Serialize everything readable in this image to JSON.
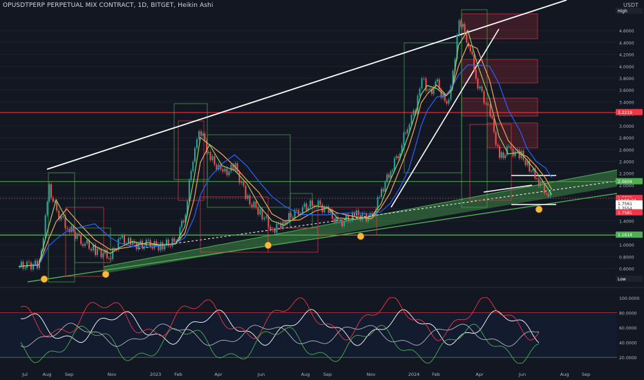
{
  "header": {
    "ticker": "OPUSDTPERP PERPETUAL MIX CONTRACT, 1D, BITGET, Heikin Ashi",
    "currency": "USDT"
  },
  "chart_data": [
    {
      "type": "line",
      "subtype": "candlestick-heikin-ashi",
      "price_axis": {
        "ticks": [
          "4.6000",
          "4.4000",
          "4.2000",
          "4.0000",
          "3.8000",
          "3.6000",
          "3.4000",
          "3.2000",
          "3.0000",
          "2.8000",
          "2.6000",
          "2.4000",
          "2.2000",
          "2.0000",
          "1.8000",
          "1.6000",
          "1.4000",
          "1.2000",
          "1.0000",
          "0.8000",
          "0.6000"
        ],
        "ylim": [
          0.35,
          4.95
        ]
      },
      "time_axis": {
        "labels": [
          "Jul",
          "Aug",
          "Sep",
          "Nov",
          "2023",
          "Feb",
          "Apr",
          "Jun",
          "Aug",
          "Sep",
          "Nov",
          "2024",
          "Feb",
          "Apr",
          "Jun",
          "Aug",
          "Sep"
        ]
      },
      "price_tags": [
        {
          "text": "High",
          "value": 4.95,
          "color": "#1e222d"
        },
        {
          "text": "3.2219",
          "value": 3.2219,
          "color": "#f23645"
        },
        {
          "text": "2.0604",
          "value": 2.0604,
          "color": "#4caf50"
        },
        {
          "text": "1.7770",
          "value": 1.777,
          "color": "#f23645"
        },
        {
          "text": "24:55:24",
          "value": 1.74,
          "color": "#f23645"
        },
        {
          "text": "1.7561",
          "value": 1.7561,
          "color": "#ffffff"
        },
        {
          "text": "1.7554",
          "value": 1.7554,
          "color": "#ffffff"
        },
        {
          "text": "1.7581",
          "value": 1.7581,
          "color": "#f23645"
        },
        {
          "text": "1.1614",
          "value": 1.1614,
          "color": "#4caf50"
        },
        {
          "text": "Low",
          "value": 0.3999,
          "color": "#1e222d"
        }
      ],
      "price_points": [
        [
          0.8,
          0.63
        ],
        [
          2.0,
          0.66
        ],
        [
          4.0,
          0.66
        ],
        [
          5.6,
          1.95
        ],
        [
          6.8,
          1.55
        ],
        [
          8.5,
          1.3
        ],
        [
          11.0,
          1.05
        ],
        [
          13.0,
          0.9
        ],
        [
          15.5,
          0.8
        ],
        [
          17.0,
          1.1
        ],
        [
          19.0,
          1.0
        ],
        [
          21.5,
          1.0
        ],
        [
          23.5,
          0.98
        ],
        [
          26.0,
          1.05
        ],
        [
          27.5,
          1.55
        ],
        [
          29.0,
          2.7
        ],
        [
          30.0,
          2.9
        ],
        [
          31.5,
          2.45
        ],
        [
          33.5,
          2.2
        ],
        [
          35.5,
          2.3
        ],
        [
          37.5,
          1.75
        ],
        [
          39.5,
          1.55
        ],
        [
          41.5,
          1.25
        ],
        [
          43.5,
          1.4
        ],
        [
          46.0,
          1.6
        ],
        [
          48.5,
          1.7
        ],
        [
          50.5,
          1.55
        ],
        [
          52.0,
          1.35
        ],
        [
          55.0,
          1.5
        ],
        [
          57.5,
          1.45
        ],
        [
          59.0,
          1.9
        ],
        [
          60.5,
          2.25
        ],
        [
          62.0,
          2.6
        ],
        [
          63.5,
          3.1
        ],
        [
          64.5,
          3.25
        ],
        [
          65.5,
          3.8
        ],
        [
          66.5,
          3.55
        ],
        [
          68.0,
          3.7
        ],
        [
          69.5,
          3.3
        ],
        [
          70.5,
          3.9
        ],
        [
          71.5,
          4.8
        ],
        [
          73.0,
          4.4
        ],
        [
          74.5,
          3.7
        ],
        [
          76.5,
          3.2
        ],
        [
          78.0,
          2.45
        ],
        [
          79.5,
          2.6
        ],
        [
          81.5,
          2.5
        ],
        [
          82.5,
          2.35
        ],
        [
          84.0,
          2.1
        ],
        [
          85.5,
          1.9
        ],
        [
          86.5,
          1.78
        ]
      ]
    },
    {
      "type": "line",
      "ylim": [
        10,
        110
      ],
      "ticks": [
        "100.0000",
        "80.0000",
        "60.0000",
        "40.0000",
        "20.0000"
      ]
    }
  ]
}
